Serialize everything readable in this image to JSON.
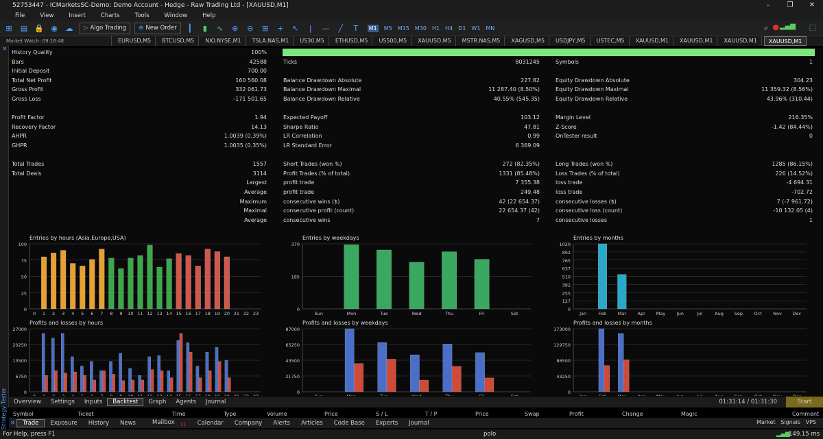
{
  "window": {
    "title": "52753447 - ICMarketsSC-Demo: Demo Account - Hedge - Raw Trading Ltd - [XAUUSD,M1]"
  },
  "menu": [
    "File",
    "View",
    "Insert",
    "Charts",
    "Tools",
    "Window",
    "Help"
  ],
  "toolbar": {
    "algo_label": "Algo Trading",
    "new_order_label": "New Order",
    "timeframes": [
      "M1",
      "M5",
      "M15",
      "M30",
      "H1",
      "H4",
      "D1",
      "W1",
      "MN"
    ],
    "active_tf": "M1"
  },
  "market_watch_label": "Market Watch: 09:16:48",
  "chart_tabs": [
    "EURUSD,M5",
    "BTCUSD,M5",
    "NIO.NYSE,M1",
    "TSLA.NAS,M1",
    "US30,M5",
    "ETHUSD,M5",
    "US500,M5",
    "XAUUSD,M5",
    "MSTR.NAS,M5",
    "XAGUSD,M5",
    "USDJPY,M5",
    "USTEC,M5",
    "XAUUSD,M1",
    "XAUUSD,M1",
    "XAUUSD,M1",
    "XAUUSD,M1"
  ],
  "report": {
    "col1": [
      [
        "History Quality",
        "100%"
      ],
      [
        "Bars",
        "42588"
      ],
      [
        "Initial Deposit",
        "700.00"
      ],
      [
        "Total Net Profit",
        "160 560.08"
      ],
      [
        "Gross Profit",
        "332 061.73"
      ],
      [
        "Gross Loss",
        "-171 501.65"
      ],
      [
        "",
        ""
      ],
      [
        "Profit Factor",
        "1.94"
      ],
      [
        "Recovery Factor",
        "14.13"
      ],
      [
        "AHPR",
        "1.0039 (0.39%)"
      ],
      [
        "GHPR",
        "1.0035 (0.35%)"
      ],
      [
        "",
        ""
      ],
      [
        "Total Trades",
        "1557"
      ],
      [
        "Total Deals",
        "3114"
      ]
    ],
    "col1b": [
      [
        "Largest"
      ],
      [
        "Average"
      ],
      [
        "Maximum"
      ],
      [
        "Maximal"
      ],
      [
        "Average"
      ]
    ],
    "col2": [
      [
        "",
        ""
      ],
      [
        "Ticks",
        "8031245"
      ],
      [
        "",
        ""
      ],
      [
        "Balance Drawdown Absolute",
        "227.82"
      ],
      [
        "Balance Drawdown Maximal",
        "11 287.40 (8.50%)"
      ],
      [
        "Balance Drawdown Relative",
        "40.55% (545.35)"
      ],
      [
        "",
        ""
      ],
      [
        "Expected Payoff",
        "103.12"
      ],
      [
        "Sharpe Ratio",
        "47.81"
      ],
      [
        "LR Correlation",
        "0.99"
      ],
      [
        "LR Standard Error",
        "6 369.09"
      ],
      [
        "",
        ""
      ],
      [
        "Short Trades (won %)",
        "272 (82.35%)"
      ],
      [
        "Profit Trades (% of total)",
        "1331 (85.48%)"
      ],
      [
        "profit trade",
        "7 355.38"
      ],
      [
        "profit trade",
        "249.48"
      ],
      [
        "consecutive wins ($)",
        "42 (22 654.37)"
      ],
      [
        "consecutive profit (count)",
        "22 654.37 (42)"
      ],
      [
        "consecutive wins",
        "7"
      ]
    ],
    "col3": [
      [
        "",
        ""
      ],
      [
        "Symbols",
        "1"
      ],
      [
        "",
        ""
      ],
      [
        "Equity Drawdown Absolute",
        "304.23"
      ],
      [
        "Equity Drawdown Maximal",
        "11 359.32 (8.56%)"
      ],
      [
        "Equity Drawdown Relative",
        "43.96% (310.44)"
      ],
      [
        "",
        ""
      ],
      [
        "Margin Level",
        "216.35%"
      ],
      [
        "Z-Score",
        "-1.42 (84.44%)"
      ],
      [
        "OnTester result",
        "0"
      ],
      [
        "",
        ""
      ],
      [
        "",
        ""
      ],
      [
        "Long Trades (won %)",
        "1285 (86.15%)"
      ],
      [
        "Loss Trades (% of total)",
        "226 (14.52%)"
      ],
      [
        "loss trade",
        "-4 694.31"
      ],
      [
        "loss trade",
        "-702.72"
      ],
      [
        "consecutive losses ($)",
        "7 (-7 961.72)"
      ],
      [
        "consecutive loss (count)",
        "-10 132.05 (4)"
      ],
      [
        "consecutive losses",
        "1"
      ]
    ]
  },
  "chart_data": [
    {
      "type": "bar",
      "title": "Entries by hours (Asia,Europe,USA)",
      "categories": [
        "0",
        "1",
        "2",
        "3",
        "4",
        "5",
        "6",
        "7",
        "8",
        "9",
        "10",
        "11",
        "12",
        "13",
        "14",
        "15",
        "16",
        "17",
        "18",
        "19",
        "20",
        "21",
        "22",
        "23"
      ],
      "values": [
        0,
        80,
        86,
        90,
        70,
        66,
        76,
        92,
        78,
        62,
        78,
        82,
        98,
        64,
        77,
        85,
        82,
        66,
        92,
        88,
        80,
        0,
        0,
        0
      ],
      "ylim": [
        0,
        100
      ],
      "yticks": [
        "0",
        "25",
        "50",
        "75",
        "100"
      ]
    },
    {
      "type": "bar",
      "title": "Entries by weekdays",
      "categories": [
        "Sun",
        "Mon",
        "Tue",
        "Wed",
        "Thu",
        "Fri",
        "Sat"
      ],
      "values": [
        0,
        365,
        335,
        265,
        325,
        282,
        0
      ],
      "ylim": [
        0,
        370
      ],
      "yticks": [
        "0",
        "185",
        "370"
      ]
    },
    {
      "type": "bar",
      "title": "Entries by months",
      "categories": [
        "Jan",
        "Feb",
        "Mar",
        "Apr",
        "May",
        "Jun",
        "Jul",
        "Aug",
        "Sep",
        "Oct",
        "Nov",
        "Dec"
      ],
      "values": [
        0,
        1020,
        540,
        0,
        0,
        0,
        0,
        0,
        0,
        0,
        0,
        0
      ],
      "ylim": [
        0,
        1020
      ],
      "yticks": [
        "0",
        "127",
        "255",
        "382",
        "510",
        "637",
        "765",
        "892",
        "1020"
      ]
    },
    {
      "type": "bar",
      "title": "Profits and losses by hours",
      "categories": [
        "0",
        "1",
        "2",
        "3",
        "4",
        "5",
        "6",
        "7",
        "8",
        "9",
        "10",
        "11",
        "12",
        "13",
        "14",
        "15",
        "16",
        "17",
        "18",
        "19",
        "20",
        "21",
        "22",
        "23"
      ],
      "series": [
        {
          "values": [
            0,
            25000,
            23000,
            25000,
            15000,
            11000,
            13000,
            9000,
            13000,
            16500,
            10000,
            7000,
            15000,
            15500,
            9000,
            22000,
            21000,
            11000,
            17000,
            19000,
            13500,
            0,
            0,
            0
          ]
        },
        {
          "values": [
            0,
            7000,
            9000,
            8000,
            8500,
            7000,
            5000,
            9000,
            7500,
            4800,
            5000,
            5000,
            9500,
            9000,
            6000,
            25000,
            17000,
            6000,
            9000,
            13000,
            6000,
            0,
            0,
            0
          ]
        }
      ],
      "ylim": [
        0,
        27000
      ],
      "yticks": [
        "0",
        "6750",
        "13500",
        "20250",
        "27000"
      ]
    },
    {
      "type": "bar",
      "title": "Profits and losses by weekdays",
      "categories": [
        "Sun",
        "Mon",
        "Tue",
        "Wed",
        "Thu",
        "Fri",
        "Sat"
      ],
      "series": [
        {
          "values": [
            0,
            87000,
            68000,
            51000,
            66000,
            54000,
            0
          ]
        },
        {
          "values": [
            0,
            39000,
            45000,
            16000,
            35000,
            19000,
            0
          ]
        }
      ],
      "ylim": [
        0,
        87000
      ],
      "yticks": [
        "0",
        "21750",
        "43500",
        "65250",
        "87000"
      ]
    },
    {
      "type": "bar",
      "title": "Profits and losses by months",
      "categories": [
        "Jan",
        "Feb",
        "Mar",
        "Apr",
        "May",
        "Jun",
        "Jul",
        "Aug",
        "Sep",
        "Oct",
        "Nov",
        "Dec"
      ],
      "series": [
        {
          "values": [
            0,
            173000,
            160000,
            0,
            0,
            0,
            0,
            0,
            0,
            0,
            0,
            0
          ]
        },
        {
          "values": [
            0,
            72000,
            88000,
            0,
            0,
            0,
            0,
            0,
            0,
            0,
            0,
            0
          ]
        }
      ],
      "ylim": [
        0,
        173000
      ],
      "yticks": [
        "0",
        "43250",
        "86500",
        "129750",
        "173000"
      ]
    }
  ],
  "bottom_tabs": [
    "Overview",
    "Settings",
    "Inputs",
    "Backtest",
    "Graph",
    "Agents",
    "Journal"
  ],
  "active_bottom_tab": "Backtest",
  "timer": "01:31:14 / 01:31:30",
  "start_label": "Start",
  "trade_header": [
    "Symbol",
    "Ticket",
    "Time",
    "Type",
    "Volume",
    "Price",
    "S / L",
    "T / P",
    "Price",
    "Swap",
    "Profit",
    "Change",
    "Magic",
    "Comment"
  ],
  "toolbox_tabs": [
    "Trade",
    "Exposure",
    "History",
    "News",
    "Mailbox",
    "Calendar",
    "Company",
    "Alerts",
    "Articles",
    "Code Base",
    "Experts",
    "Journal"
  ],
  "mailbox_badge": "11",
  "market_labels": [
    "Market",
    "Signals",
    "VPS"
  ],
  "status": {
    "help": "For Help, press F1",
    "profile": "polo",
    "ping": "149.15 ms"
  },
  "strategy_tester_label": "Strategy Tester",
  "toolbox_label": "Toolbox"
}
